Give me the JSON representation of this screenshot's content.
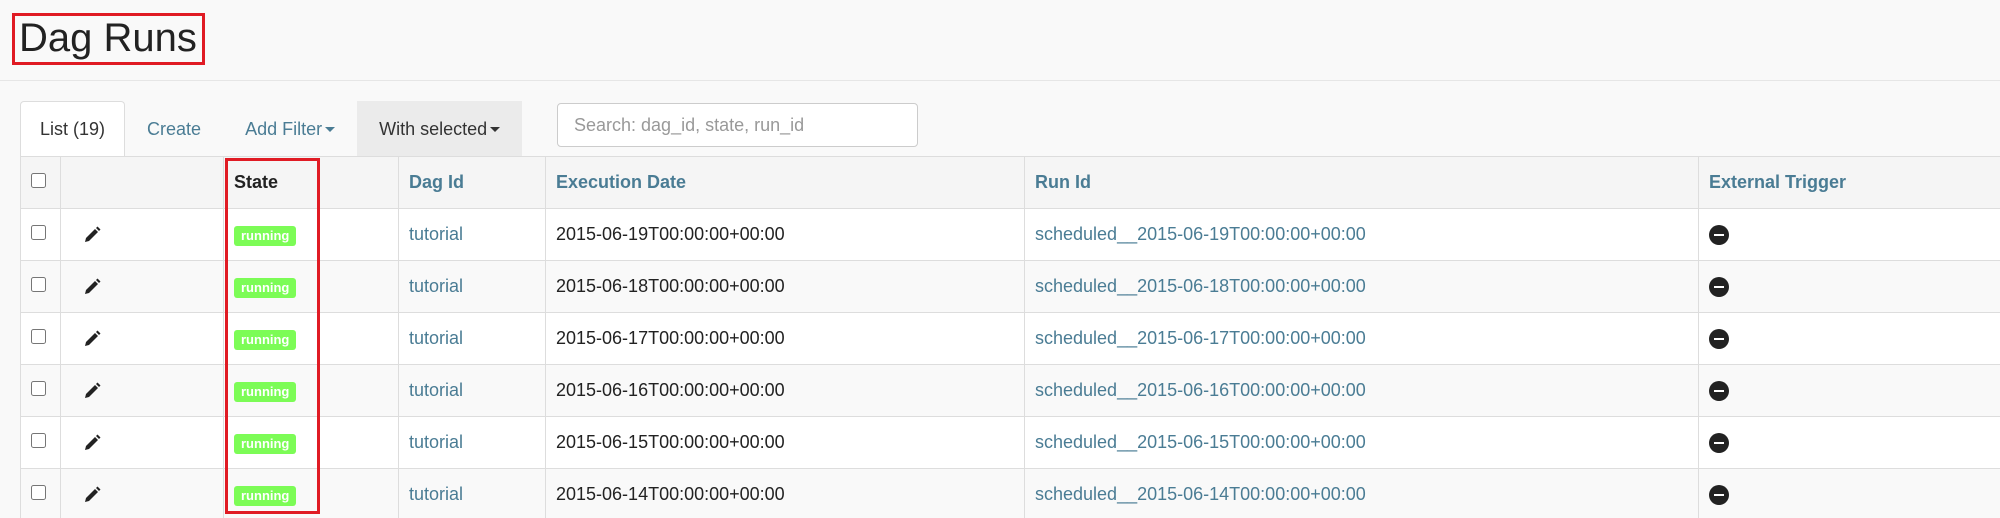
{
  "page": {
    "title": "Dag Runs"
  },
  "tabs": {
    "list": "List (19)",
    "create": "Create",
    "add_filter": "Add Filter",
    "with_selected": "With selected"
  },
  "search": {
    "placeholder": "Search: dag_id, state, run_id"
  },
  "table": {
    "headers": {
      "state": "State",
      "dag_id": "Dag Id",
      "execution_date": "Execution Date",
      "run_id": "Run Id",
      "external_trigger": "External Trigger"
    },
    "rows": [
      {
        "state": "running",
        "dag_id": "tutorial",
        "execution_date": "2015-06-19T00:00:00+00:00",
        "run_id": "scheduled__2015-06-19T00:00:00+00:00",
        "external_trigger_icon": "minus-circle-icon"
      },
      {
        "state": "running",
        "dag_id": "tutorial",
        "execution_date": "2015-06-18T00:00:00+00:00",
        "run_id": "scheduled__2015-06-18T00:00:00+00:00",
        "external_trigger_icon": "minus-circle-icon"
      },
      {
        "state": "running",
        "dag_id": "tutorial",
        "execution_date": "2015-06-17T00:00:00+00:00",
        "run_id": "scheduled__2015-06-17T00:00:00+00:00",
        "external_trigger_icon": "minus-circle-icon"
      },
      {
        "state": "running",
        "dag_id": "tutorial",
        "execution_date": "2015-06-16T00:00:00+00:00",
        "run_id": "scheduled__2015-06-16T00:00:00+00:00",
        "external_trigger_icon": "minus-circle-icon"
      },
      {
        "state": "running",
        "dag_id": "tutorial",
        "execution_date": "2015-06-15T00:00:00+00:00",
        "run_id": "scheduled__2015-06-15T00:00:00+00:00",
        "external_trigger_icon": "minus-circle-icon"
      },
      {
        "state": "running",
        "dag_id": "tutorial",
        "execution_date": "2015-06-14T00:00:00+00:00",
        "run_id": "scheduled__2015-06-14T00:00:00+00:00",
        "external_trigger_icon": "minus-circle-icon"
      }
    ]
  },
  "colors": {
    "highlight_border": "#e01b24",
    "running_badge": "#7cfc56",
    "link": "#4a7c94"
  }
}
